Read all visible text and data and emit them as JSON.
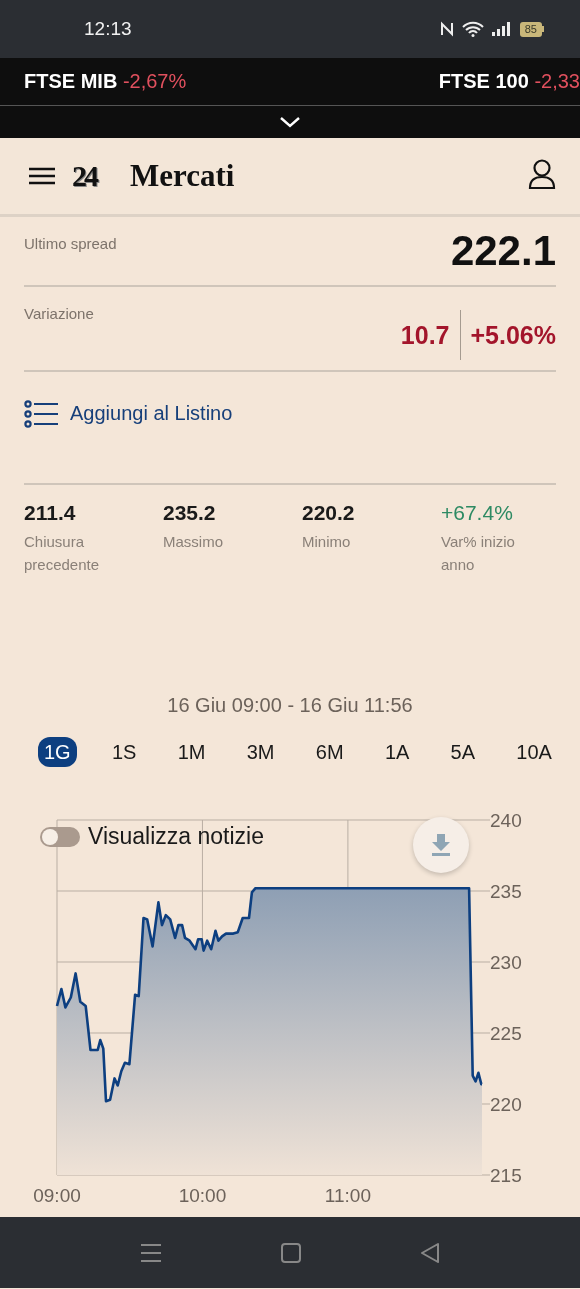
{
  "status_bar": {
    "time": "12:13",
    "battery": "85"
  },
  "ticker": [
    {
      "name": "FTSE MIB",
      "change": "-2,67%"
    },
    {
      "name": "FTSE 100",
      "change": "-2,33"
    }
  ],
  "header": {
    "logo": "24",
    "title": "Mercati"
  },
  "spread": {
    "label": "Ultimo spread",
    "value": "222.1"
  },
  "variation": {
    "label": "Variazione",
    "points": "10.7",
    "percent": "+5.06%"
  },
  "watchlist_link": "Aggiungi al Listino",
  "stats": [
    {
      "value": "211.4",
      "label": "Chiusura precedente",
      "kind": "plain"
    },
    {
      "value": "235.2",
      "label": "Massimo",
      "kind": "plain"
    },
    {
      "value": "220.2",
      "label": "Minimo",
      "kind": "plain"
    },
    {
      "value": "+67.4%",
      "label": "Var% inizio anno",
      "kind": "positive"
    }
  ],
  "chart": {
    "range_label": "16 Giu 09:00 - 16 Giu 11:56",
    "ranges": [
      {
        "label": "1G",
        "selected": true
      },
      {
        "label": "1S",
        "selected": false
      },
      {
        "label": "1M",
        "selected": false
      },
      {
        "label": "3M",
        "selected": false
      },
      {
        "label": "6M",
        "selected": false
      },
      {
        "label": "1A",
        "selected": false
      },
      {
        "label": "5A",
        "selected": false
      },
      {
        "label": "10A",
        "selected": false
      }
    ],
    "news_toggle": {
      "label": "Visualizza notizie",
      "on": false
    },
    "chart_data": {
      "type": "area",
      "x": [
        9,
        9.03,
        9.058,
        9.095,
        9.128,
        9.16,
        9.197,
        9.23,
        9.28,
        9.298,
        9.318,
        9.337,
        9.365,
        9.395,
        9.417,
        9.442,
        9.467,
        9.498,
        9.537,
        9.562,
        9.595,
        9.62,
        9.657,
        9.697,
        9.722,
        9.748,
        9.778,
        9.812,
        9.835,
        9.86,
        9.88,
        9.912,
        9.952,
        9.97,
        9.995,
        10.008,
        10.033,
        10.06,
        10.09,
        10.11,
        10.135,
        10.162,
        10.212,
        10.243,
        10.277,
        10.32,
        10.34,
        10.365,
        11.833,
        11.858,
        11.878,
        11.897,
        11.917,
        11.922
      ],
      "series": [
        {
          "color": "#0d3f80",
          "values": [
            226.9,
            228.1,
            226.8,
            227.5,
            229.2,
            227.2,
            226.9,
            223.8,
            223.8,
            224.5,
            223.9,
            220.2,
            220.3,
            221.8,
            221.3,
            222.3,
            222.9,
            222.8,
            227.7,
            227.6,
            233.1,
            233,
            231.1,
            234.2,
            232.6,
            233.3,
            233,
            231.7,
            232.6,
            232.6,
            231.7,
            231.5,
            230.9,
            231.6,
            231.6,
            230.8,
            231.5,
            230.9,
            232.2,
            231.5,
            231.8,
            232,
            232,
            232.1,
            233.1,
            233.1,
            234.9,
            235.2,
            235.2,
            222,
            221.6,
            222.2,
            221.4,
            221.4
          ]
        }
      ],
      "grid": true,
      "xlim": [
        9,
        11.922
      ],
      "ylim": [
        215,
        240
      ],
      "xticks": [
        {
          "value": 9,
          "label": "09:00"
        },
        {
          "value": 10,
          "label": "10:00"
        },
        {
          "value": 11,
          "label": "11:00"
        }
      ],
      "yticks": [
        215,
        220,
        225,
        230,
        235,
        240
      ]
    }
  }
}
